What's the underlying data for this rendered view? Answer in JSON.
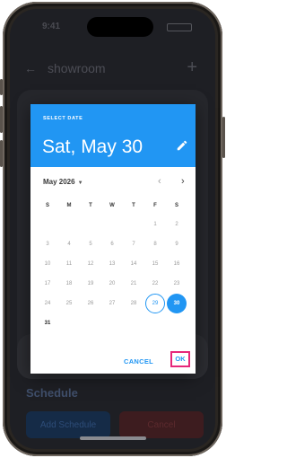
{
  "status_bar": {
    "time": "9:41"
  },
  "app_bar": {
    "back_icon": "arrow-left-icon",
    "title": "showroom",
    "add_icon": "plus-icon"
  },
  "background": {
    "section_title": "Schedule",
    "add_schedule_button": "Add Schedule",
    "cancel_button": "Cancel"
  },
  "date_picker": {
    "header_label": "SELECT DATE",
    "selected_date_text": "Sat, May 30",
    "edit_icon": "pencil-icon",
    "month_label": "May 2026",
    "month_dropdown_icon": "caret-down-icon",
    "prev_icon": "chevron-left-icon",
    "next_icon": "chevron-right-icon",
    "weekdays": [
      "S",
      "M",
      "T",
      "W",
      "T",
      "F",
      "S"
    ],
    "leading_blanks": 5,
    "days": [
      "1",
      "2",
      "3",
      "4",
      "5",
      "6",
      "7",
      "8",
      "9",
      "10",
      "11",
      "12",
      "13",
      "14",
      "15",
      "16",
      "17",
      "18",
      "19",
      "20",
      "21",
      "22",
      "23",
      "24",
      "25",
      "26",
      "27",
      "28",
      "29",
      "30",
      "31"
    ],
    "today": "29",
    "selected": "30",
    "enabled_days": [
      "29",
      "30",
      "31"
    ],
    "cancel_label": "CANCEL",
    "ok_label": "OK",
    "accent_color": "#2196f3",
    "highlight_color": "#e6277a"
  }
}
